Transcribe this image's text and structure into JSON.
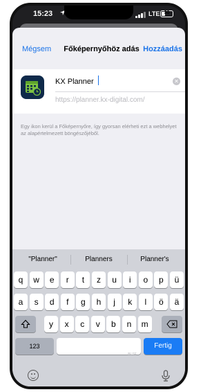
{
  "status": {
    "time": "15:23",
    "location_icon": "location-arrow-icon",
    "network": "LTE",
    "battery": "30",
    "battery_level": 0.3
  },
  "sheet": {
    "cancel_label": "Mégsem",
    "title": "Főképernyőhöz adás",
    "add_label": "Hozzáadás",
    "app_name_value": "KX Planner",
    "url": "https://planner.kx-digital.com/",
    "description": "Egy ikon kerül a Főképernyőre, így gyorsan elérheti ezt a webhelyet az alapértelmezett böngészőjéből."
  },
  "keyboard": {
    "suggestions": [
      "\"Planner\"",
      "Planners",
      "Planner's"
    ],
    "row1": [
      "q",
      "w",
      "e",
      "r",
      "t",
      "z",
      "u",
      "i",
      "o",
      "p",
      "ü"
    ],
    "row2": [
      "a",
      "s",
      "d",
      "f",
      "g",
      "h",
      "j",
      "k",
      "l",
      "ö",
      "ä"
    ],
    "row3": [
      "y",
      "x",
      "c",
      "v",
      "b",
      "n",
      "m"
    ],
    "numbers_label": "123",
    "space_hint": "BLSE",
    "return_label": "Fertig",
    "shift_icon": "shift-icon",
    "delete_icon": "delete-icon",
    "emoji_icon": "emoji-icon",
    "mic_icon": "microphone-icon"
  }
}
